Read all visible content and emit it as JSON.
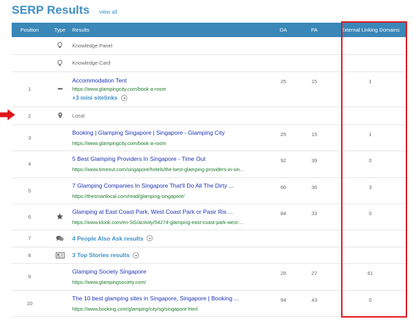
{
  "header": {
    "title": "SERP Results",
    "view_all": "view all"
  },
  "columns": {
    "position": "Position",
    "type": "Type",
    "results": "Results",
    "da": "DA",
    "pa": "PA",
    "eld": "External Linking Domains"
  },
  "rows": [
    {
      "position": "",
      "type_icon": "lightbulb-icon",
      "label": "Knowledge Panel"
    },
    {
      "position": "",
      "type_icon": "lightbulb-icon",
      "label": "Knowledge Card"
    },
    {
      "position": "1",
      "type_icon": "more-dots-icon",
      "title": "Accommodation Tent",
      "url": "https://www.glampingcity.com/book-a-room",
      "sitelinks": "+3 mini sitelinks",
      "da": "25",
      "pa": "15",
      "eld": "1"
    },
    {
      "position": "2",
      "type_icon": "map-pin-icon",
      "label": "Local"
    },
    {
      "position": "3",
      "type_icon": "",
      "title": "Booking | Glamping Singapore | Singapore - Glamping City",
      "url": "https://www.glampingcity.com/book-a-room",
      "da": "25",
      "pa": "15",
      "eld": "1"
    },
    {
      "position": "4",
      "type_icon": "",
      "title": "5 Best Glamping Providers In Singapore - Time Out",
      "url": "https://www.timeout.com/singapore/hotels/the-best-glamping-providers-in-sin...",
      "da": "92",
      "pa": "39",
      "eld": "0"
    },
    {
      "position": "5",
      "type_icon": "",
      "title": "7 Glamping Companies In Singapore That'll Do All The Dirty ...",
      "url": "https://thesmartlocal.com/read/glamping-singapore/",
      "da": "60",
      "pa": "36",
      "eld": "3"
    },
    {
      "position": "6",
      "type_icon": "star-icon",
      "title": "Glamping at East Coast Park, West Coast Park or Pasir Ris ...",
      "url": "https://www.klook.com/en-SG/activity/54274-glamping-east-coast-park-west-...",
      "da": "84",
      "pa": "33",
      "eld": "0"
    },
    {
      "position": "7",
      "type_icon": "speech-bubbles-icon",
      "feature": "4 People Also Ask results"
    },
    {
      "position": "8",
      "type_icon": "news-icon",
      "feature": "3 Top Stories results"
    },
    {
      "position": "9",
      "type_icon": "",
      "title": "Glamping Society Singapore",
      "url": "https://www.glampingsociety.com/",
      "da": "28",
      "pa": "27",
      "eld": "61"
    },
    {
      "position": "10",
      "type_icon": "",
      "title": "The 10 best glamping sites in Singapore, Singapore | Booking ...",
      "url": "https://www.booking.com/glamping/city/sg/singapore.html",
      "da": "94",
      "pa": "43",
      "eld": "0"
    }
  ],
  "colors": {
    "header_bg": "#3a87b8",
    "title_blue": "#3e8fc5",
    "link_title": "#1f32b5",
    "url_green": "#1b7a2a",
    "highlight_red": "#e0161b"
  }
}
